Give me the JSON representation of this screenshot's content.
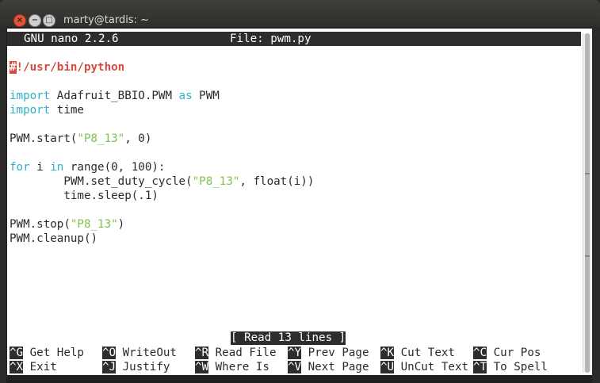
{
  "window": {
    "title": "marty@tardis: ~",
    "close_glyph": "×",
    "minimize_glyph": "−",
    "maximize_glyph": "□"
  },
  "nano_header": {
    "version": "GNU nano 2.2.6",
    "file_label": "File: pwm.py"
  },
  "code": {
    "shebang_cursor": "#",
    "shebang_rest": "!/usr/bin/python",
    "line3_kw": "import",
    "line3_mid": " Adafruit_BBIO.PWM ",
    "line3_kw2": "as",
    "line3_end": " PWM",
    "line4_kw": "import",
    "line4_end": " time",
    "line6_start": "PWM.start(",
    "line6_str": "\"P8_13\"",
    "line6_end": ", 0)",
    "line8_kw": "for",
    "line8_mid": " i ",
    "line8_kw2": "in",
    "line8_end": " range(0, 100):",
    "line9_start": "        PWM.set_duty_cycle(",
    "line9_str": "\"P8_13\"",
    "line9_end": ", float(i))",
    "line10": "        time.sleep(.1)",
    "line12_start": "PWM.stop(",
    "line12_str": "\"P8_13\"",
    "line12_end": ")",
    "line13": "PWM.cleanup()"
  },
  "status_message": "[ Read 13 lines ]",
  "shortcuts": [
    {
      "key": "^G",
      "label": " Get Help"
    },
    {
      "key": "^O",
      "label": " WriteOut"
    },
    {
      "key": "^R",
      "label": " Read File"
    },
    {
      "key": "^Y",
      "label": " Prev Page"
    },
    {
      "key": "^K",
      "label": " Cut Text"
    },
    {
      "key": "^C",
      "label": " Cur Pos"
    },
    {
      "key": "^X",
      "label": " Exit"
    },
    {
      "key": "^J",
      "label": " Justify"
    },
    {
      "key": "^W",
      "label": " Where Is"
    },
    {
      "key": "^V",
      "label": " Next Page"
    },
    {
      "key": "^U",
      "label": " UnCut Text"
    },
    {
      "key": "^T",
      "label": " To Spell"
    }
  ],
  "colors": {
    "keyword": "#2ab3c9",
    "string": "#7dc34a",
    "shebang": "#d84a3e",
    "bar_background": "#2d2d2d"
  }
}
